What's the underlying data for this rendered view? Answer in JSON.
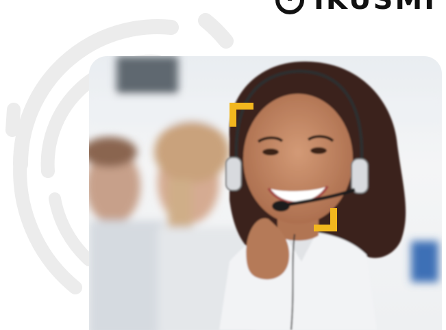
{
  "brand": {
    "name": "IKUSMI",
    "logo_icon": "circular-logo-mark-icon"
  },
  "hero": {
    "image_icon": "call-center-agent-photo",
    "frame_icon": "focus-corner-brackets-icon",
    "accent_color": "#f2b71e"
  },
  "decor": {
    "pattern_icon": "concentric-arcs-pattern-icon",
    "pattern_color": "#ebebeb"
  }
}
